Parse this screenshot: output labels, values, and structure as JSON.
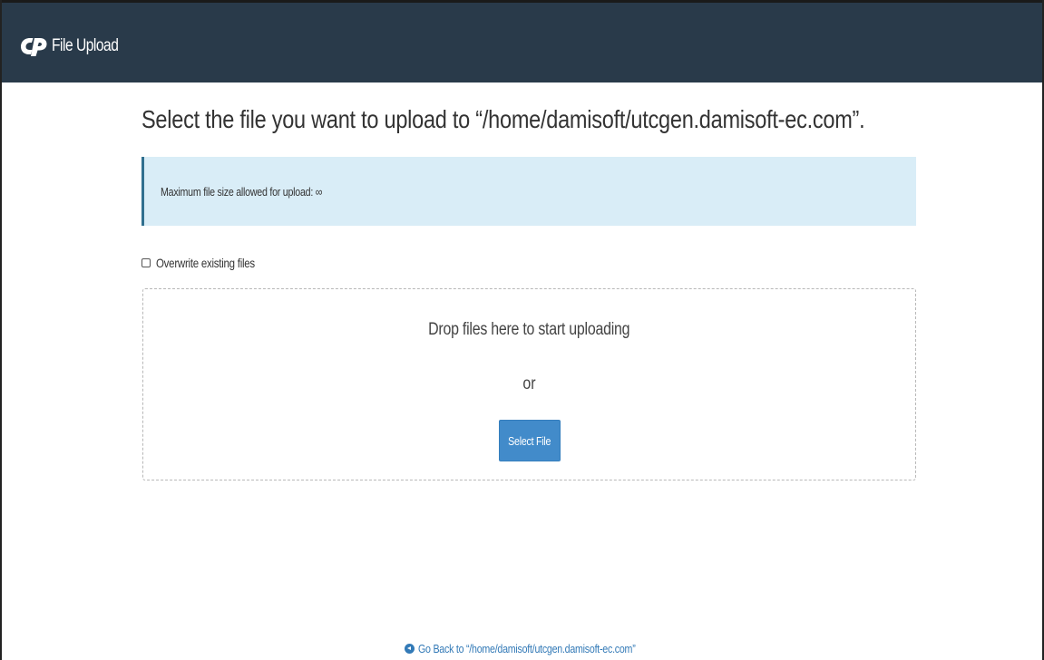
{
  "header": {
    "title": "File Upload",
    "logo_icon": "cpanel-logo-icon",
    "background_color": "#293a4a"
  },
  "main": {
    "heading": "Select the file you want to upload to “/home/damisoft/utcgen.damisoft-ec.com”.",
    "info_message": "Maximum file size allowed for upload: ∞",
    "overwrite_label": "Overwrite existing files",
    "overwrite_checked": false
  },
  "dropzone": {
    "prompt": "Drop files here to start uploading",
    "or_text": "or",
    "select_button_label": "Select File"
  },
  "footer": {
    "go_back_icon": "arrow-circle-left-icon",
    "go_back_label": "Go Back to “/home/damisoft/utcgen.damisoft-ec.com”"
  },
  "colors": {
    "info_background": "#d9edf7",
    "button_primary": "#428bca",
    "link": "#337ab7"
  }
}
